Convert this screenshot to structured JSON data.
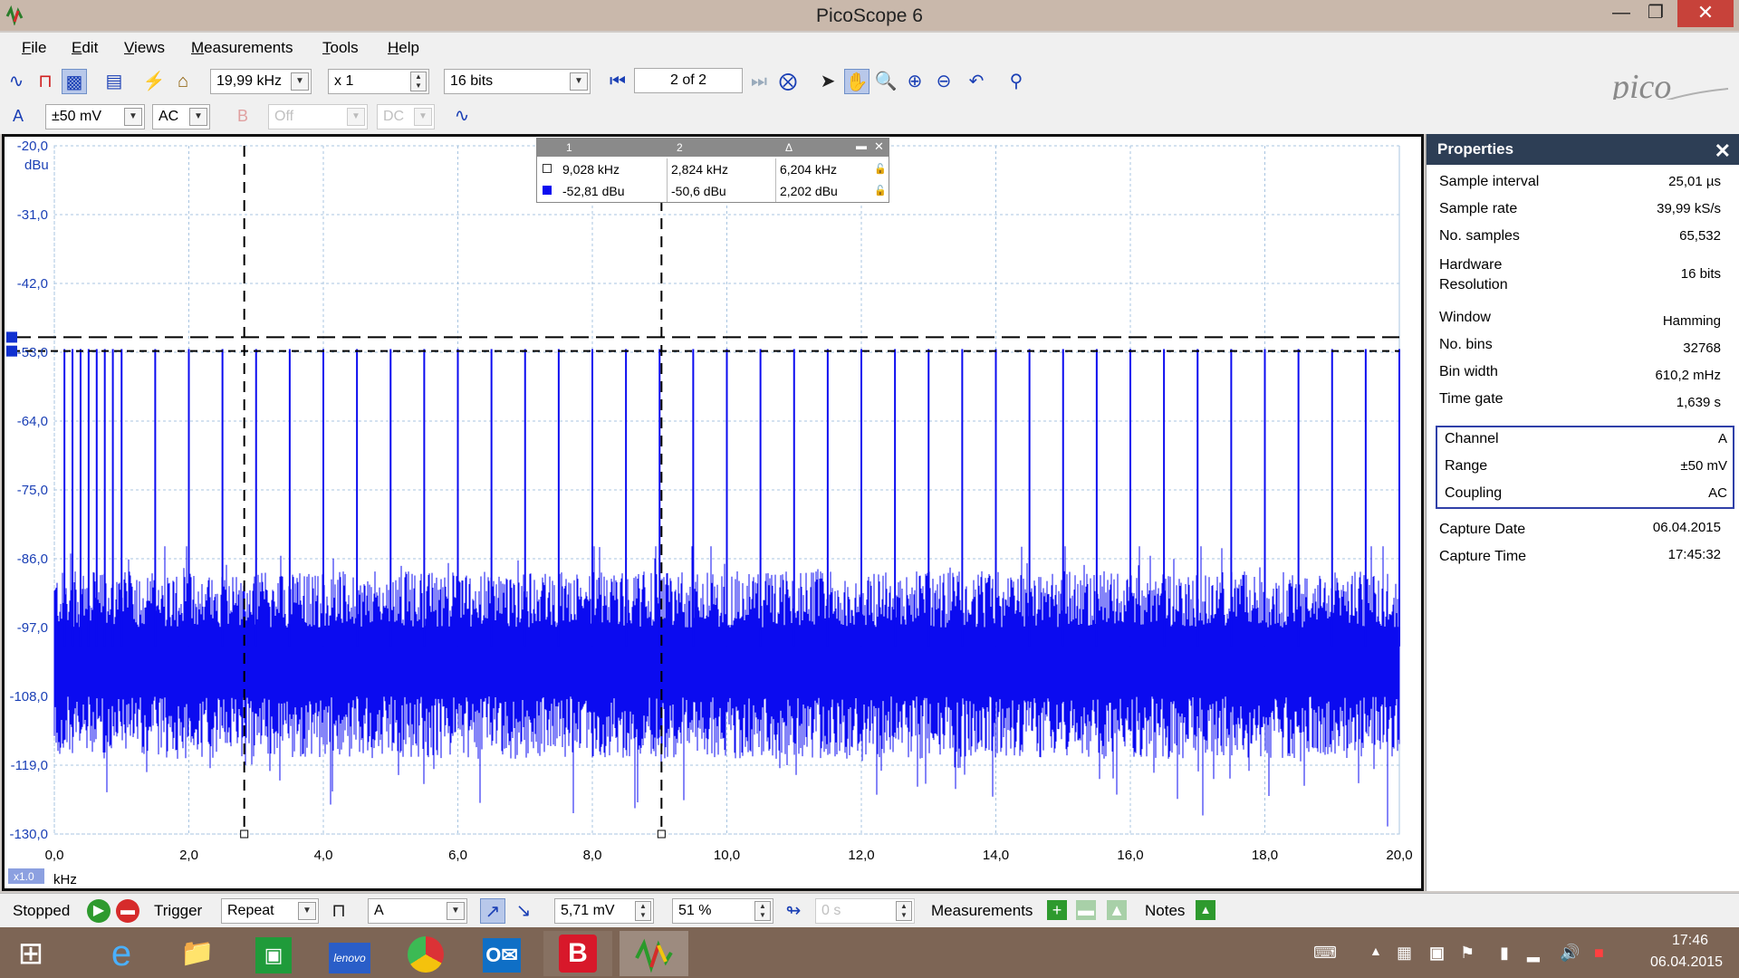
{
  "window": {
    "title": "PicoScope 6",
    "minimize": "—",
    "maximize": "❐",
    "close": "✕"
  },
  "menu": [
    "File",
    "Edit",
    "Views",
    "Measurements",
    "Tools",
    "Help"
  ],
  "toolbar": {
    "spectrum_range": "19,99 kHz",
    "zoom_factor": "x 1",
    "resolution": "16 bits",
    "buffer_page": "2 of 2"
  },
  "channels": {
    "a": {
      "label": "A",
      "range": "±50 mV",
      "coupling": "AC"
    },
    "b": {
      "label": "B",
      "range": "Off",
      "coupling": "DC"
    }
  },
  "scope": {
    "y_unit": "dBu",
    "x_unit": "kHz",
    "x_zoom": "x1.0",
    "y_ticks": [
      "-20,0",
      "-31,0",
      "-42,0",
      "-53,0",
      "-64,0",
      "-75,0",
      "-86,0",
      "-97,0",
      "-108,0",
      "-119,0",
      "-130,0"
    ],
    "x_ticks": [
      "0,0",
      "2,0",
      "4,0",
      "6,0",
      "8,0",
      "10,0",
      "12,0",
      "14,0",
      "16,0",
      "18,0",
      "20,0"
    ],
    "trace_color": "#0b0bf0"
  },
  "rulers": {
    "headers": [
      "1",
      "2",
      "Δ"
    ],
    "freq": [
      "9,028 kHz",
      "2,824 kHz",
      "6,204 kHz"
    ],
    "level": [
      "-52,81 dBu",
      "-50,6 dBu",
      "2,202 dBu"
    ]
  },
  "properties": {
    "title": "Properties",
    "items": [
      {
        "label": "Sample interval",
        "value": "25,01 µs"
      },
      {
        "label": "Sample rate",
        "value": "39,99 kS/s"
      },
      {
        "label": "No. samples",
        "value": "65,532"
      },
      {
        "label": "Hardware Resolution",
        "value": "16 bits"
      },
      {
        "label": "Window",
        "value": "Hamming"
      },
      {
        "label": "No. bins",
        "value": "32768"
      },
      {
        "label": "Bin width",
        "value": "610,2 mHz"
      },
      {
        "label": "Time gate",
        "value": "1,639 s"
      }
    ],
    "channel": [
      {
        "label": "Channel",
        "value": "A"
      },
      {
        "label": "Range",
        "value": "±50 mV"
      },
      {
        "label": "Coupling",
        "value": "AC"
      }
    ],
    "capture": [
      {
        "label": "Capture Date",
        "value": "06.04.2015"
      },
      {
        "label": "Capture Time",
        "value": "17:45:32"
      }
    ]
  },
  "status": {
    "state": "Stopped",
    "trigger_label": "Trigger",
    "trigger_mode": "Repeat",
    "trigger_channel": "A",
    "threshold": "5,71 mV",
    "pretrigger": "51 %",
    "delay": "0 s",
    "measurements_label": "Measurements",
    "notes_label": "Notes"
  },
  "taskbar": {
    "time": "17:46",
    "date": "06.04.2015",
    "lenovo": "lenovo",
    "b_app": "B"
  }
}
